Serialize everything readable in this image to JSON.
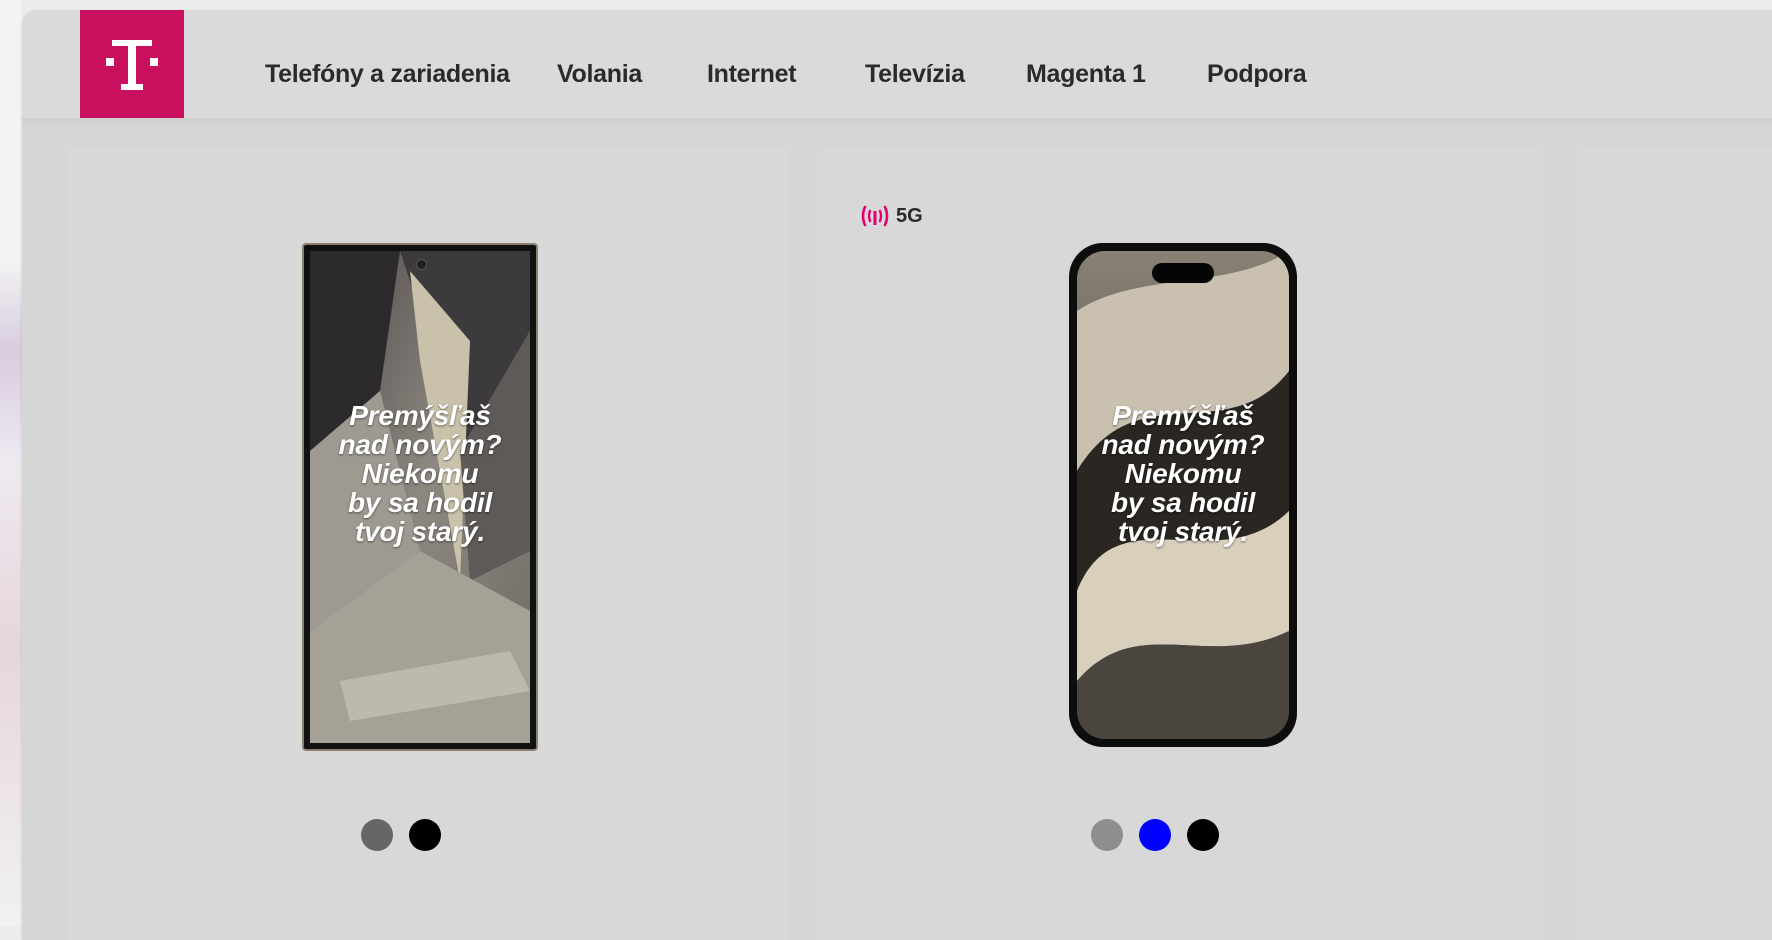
{
  "brand": {
    "logo_letter": "T",
    "logo_color": "#c8105f"
  },
  "nav": {
    "items": [
      {
        "label": "Telefóny a zariadenia"
      },
      {
        "label": "Volania"
      },
      {
        "label": "Internet"
      },
      {
        "label": "Televízia"
      },
      {
        "label": "Magenta 1"
      },
      {
        "label": "Podpora"
      }
    ]
  },
  "products": [
    {
      "badge": "",
      "phone_icon": "samsung-phone-icon",
      "promo": {
        "headline": "Premýšľaš\nnad novým?\nNiekomu\nby sa hodil\ntvoj starý.",
        "small_text": "",
        "cta": ""
      },
      "colors": [
        "#666666",
        "#000000"
      ]
    },
    {
      "badge": "5G",
      "badge_icon": "signal-5g-icon",
      "phone_icon": "iphone-icon",
      "promo": {
        "headline": "Premýšľaš\nnad novým?\nNiekomu\nby sa hodil\ntvoj starý.",
        "small_text": "",
        "cta": ""
      },
      "colors": [
        "#8e8e8e",
        "#0000ff",
        "#000000"
      ]
    }
  ]
}
